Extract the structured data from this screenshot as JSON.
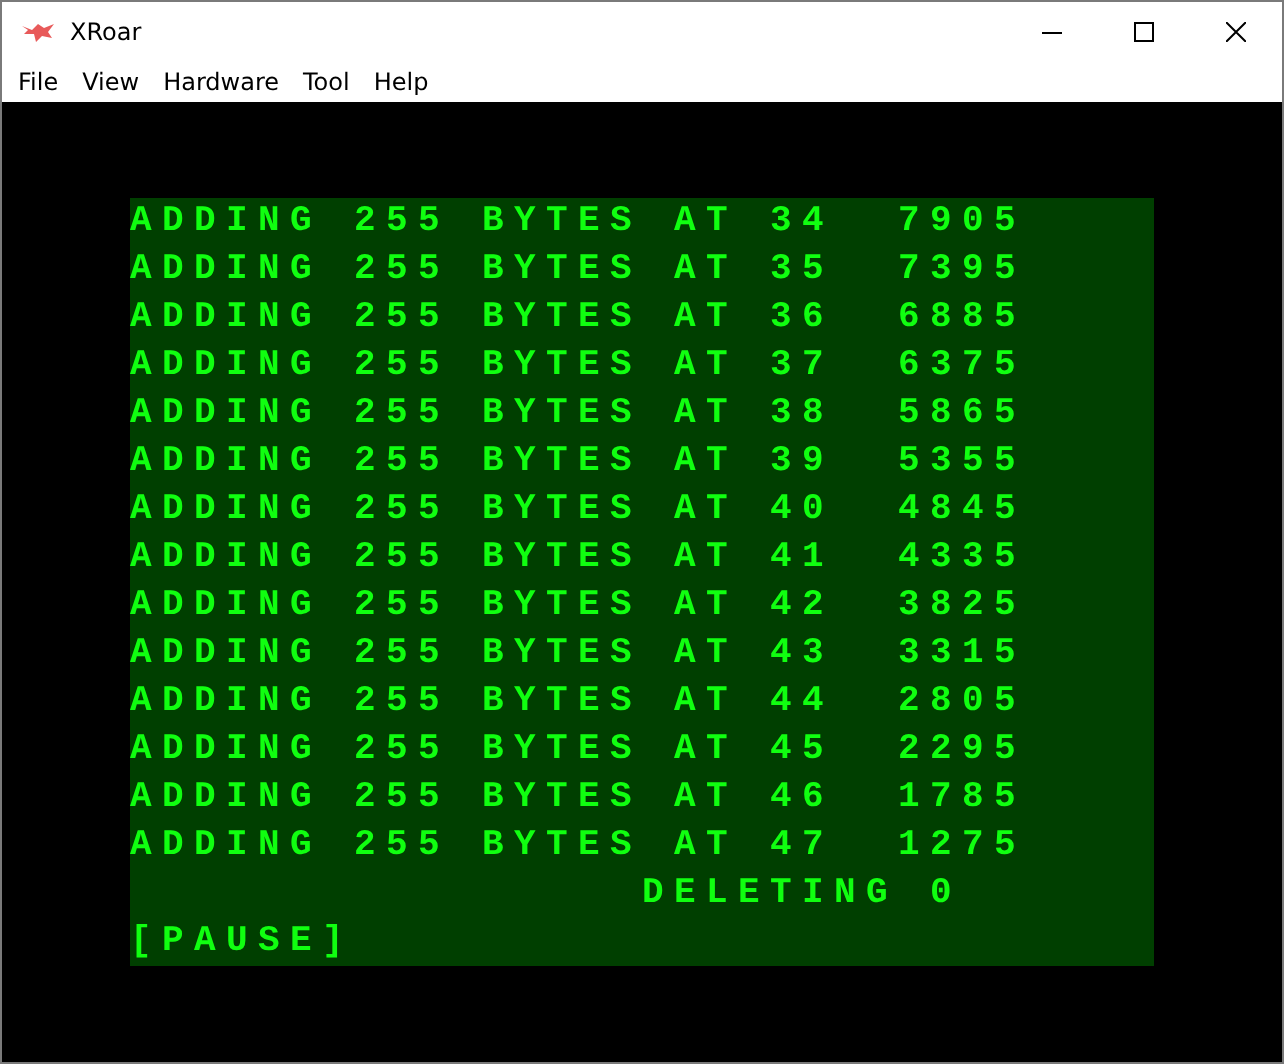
{
  "window": {
    "title": "XRoar"
  },
  "menu": [
    "File",
    "View",
    "Hardware",
    "Tool",
    "Help"
  ],
  "screen": {
    "lines": [
      {
        "kind": "line",
        "text": "ADDING 255 BYTES AT 34  7905"
      },
      {
        "kind": "line",
        "text": "ADDING 255 BYTES AT 35  7395"
      },
      {
        "kind": "line",
        "text": "ADDING 255 BYTES AT 36  6885"
      },
      {
        "kind": "line",
        "text": "ADDING 255 BYTES AT 37  6375"
      },
      {
        "kind": "line",
        "text": "ADDING 255 BYTES AT 38  5865"
      },
      {
        "kind": "line",
        "text": "ADDING 255 BYTES AT 39  5355"
      },
      {
        "kind": "line",
        "text": "ADDING 255 BYTES AT 40  4845"
      },
      {
        "kind": "line",
        "text": "ADDING 255 BYTES AT 41  4335"
      },
      {
        "kind": "line",
        "text": "ADDING 255 BYTES AT 42  3825"
      },
      {
        "kind": "line",
        "text": "ADDING 255 BYTES AT 43  3315"
      },
      {
        "kind": "line",
        "text": "ADDING 255 BYTES AT 44  2805"
      },
      {
        "kind": "line",
        "text": "ADDING 255 BYTES AT 45  2295"
      },
      {
        "kind": "line",
        "text": "ADDING 255 BYTES AT 46  1785"
      },
      {
        "kind": "line",
        "text": "ADDING 255 BYTES AT 47  1275"
      },
      {
        "kind": "status",
        "text": "DELETING 0"
      },
      {
        "kind": "line",
        "text": "[PAUSE]"
      }
    ]
  }
}
